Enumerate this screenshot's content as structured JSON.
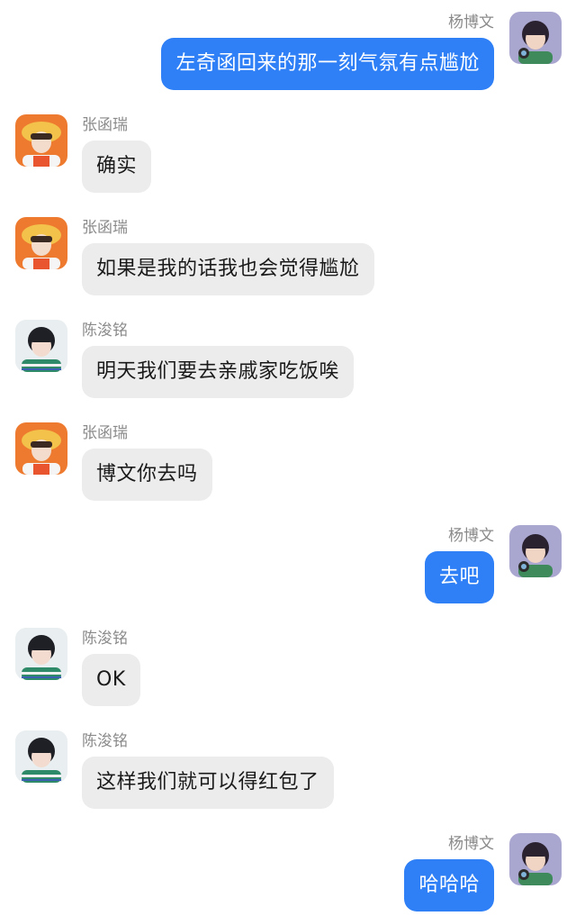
{
  "colors": {
    "incoming_bubble": "#ececec",
    "outgoing_bubble": "#2f80f6",
    "sender_name": "#8a8a8a"
  },
  "messages": [
    {
      "side": "right",
      "sender": "杨博文",
      "text": "左奇函回来的那一刻气氛有点尴尬",
      "avatar": "avatar-yang"
    },
    {
      "side": "left",
      "sender": "张函瑞",
      "text": "确实",
      "avatar": "avatar-zhang"
    },
    {
      "side": "left",
      "sender": "张函瑞",
      "text": "如果是我的话我也会觉得尴尬",
      "avatar": "avatar-zhang"
    },
    {
      "side": "left",
      "sender": "陈浚铭",
      "text": "明天我们要去亲戚家吃饭唉",
      "avatar": "avatar-chen"
    },
    {
      "side": "left",
      "sender": "张函瑞",
      "text": "博文你去吗",
      "avatar": "avatar-zhang"
    },
    {
      "side": "right",
      "sender": "杨博文",
      "text": "去吧",
      "avatar": "avatar-yang"
    },
    {
      "side": "left",
      "sender": "陈浚铭",
      "text": "OK",
      "avatar": "avatar-chen"
    },
    {
      "side": "left",
      "sender": "陈浚铭",
      "text": "这样我们就可以得红包了",
      "avatar": "avatar-chen"
    },
    {
      "side": "right",
      "sender": "杨博文",
      "text": "哈哈哈",
      "avatar": "avatar-yang"
    }
  ]
}
